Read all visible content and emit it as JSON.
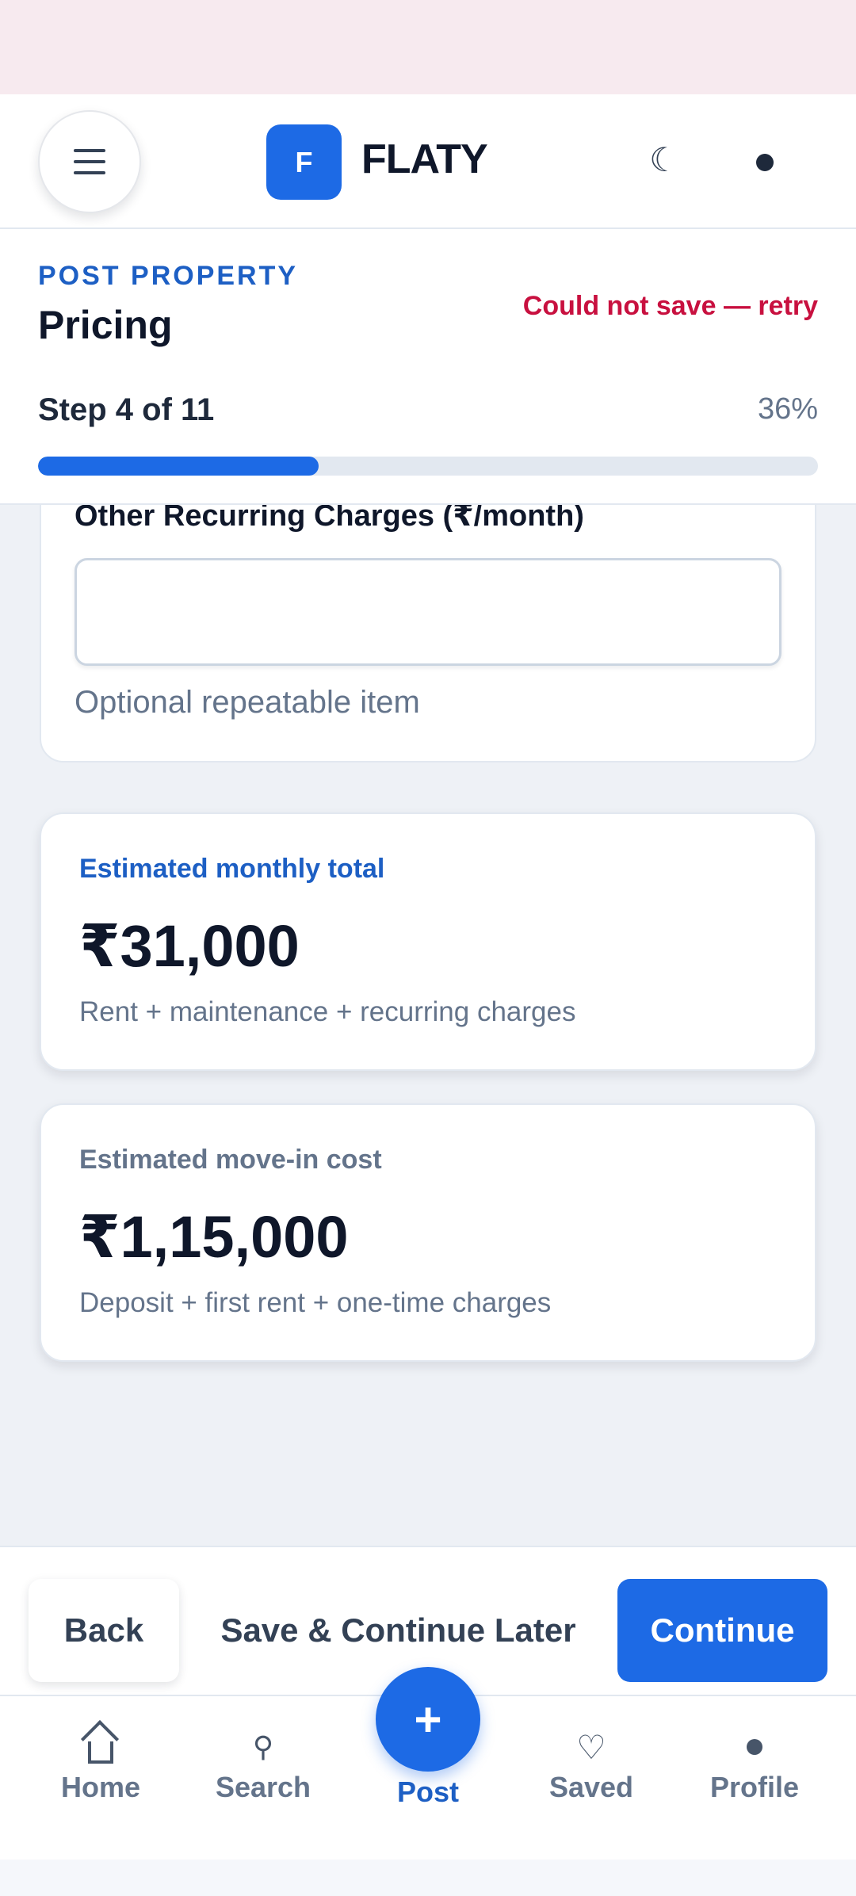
{
  "header": {
    "logo_letter": "F",
    "brand_name": "FLATY",
    "theme_icon": "☾"
  },
  "step": {
    "eyebrow": "POST PROPERTY",
    "title": "Pricing",
    "save_status": "Could not save — retry",
    "count_text": "Step 4 of 11",
    "percent_text": "36%",
    "progress": 0.36
  },
  "field": {
    "label": "Other Recurring Charges (₹/month)",
    "value": "",
    "hint": "Optional repeatable item"
  },
  "monthly_card": {
    "label": "Estimated monthly total",
    "amount": "₹31,000",
    "sub": "Rent + maintenance + recurring charges"
  },
  "movein_card": {
    "label": "Estimated move-in cost",
    "amount": "₹1,15,000",
    "sub": "Deposit + first rent + one-time charges"
  },
  "actions": {
    "back": "Back",
    "later": "Save & Continue Later",
    "continue": "Continue"
  },
  "nav": {
    "home": "Home",
    "search": "Search",
    "post_icon": "+",
    "post": "Post",
    "saved": "Saved",
    "profile": "Profile"
  },
  "colors": {
    "accent": "#1d6ae5",
    "error": "#c8103f",
    "eyebrow": "#1d5fc4"
  },
  "icons": [
    "menu-icon",
    "moon-icon",
    "account-icon",
    "home-icon",
    "search-icon",
    "plus-icon",
    "heart-icon",
    "profile-icon"
  ]
}
